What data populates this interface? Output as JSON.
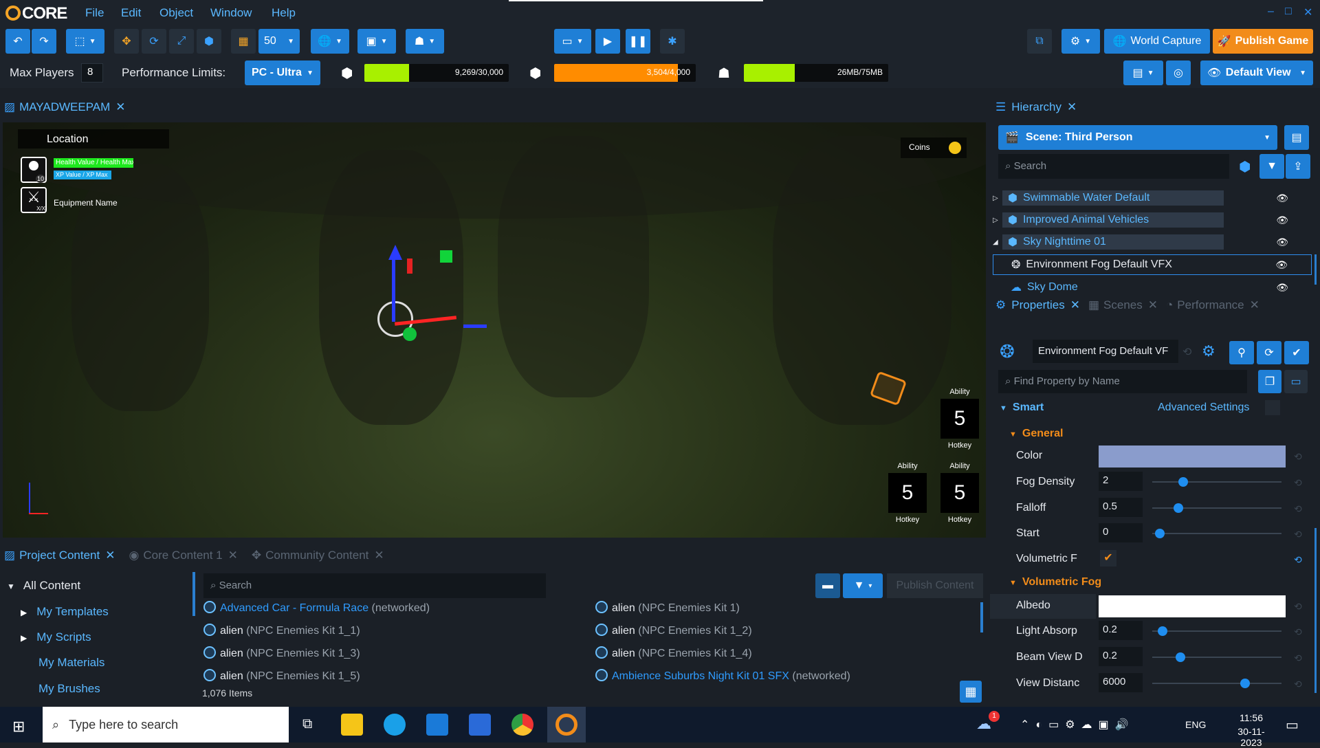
{
  "app": {
    "logo_text": "CORE",
    "accent": "#1f8ef0",
    "orange": "#f28c1a"
  },
  "menu": [
    "File",
    "Edit",
    "Object",
    "Window",
    "Help"
  ],
  "window_controls": [
    "–",
    "□",
    "✕"
  ],
  "toolbar": {
    "grid_value": "50",
    "world_capture": "World Capture",
    "publish_game": "Publish Game"
  },
  "perf": {
    "max_players_label": "Max Players",
    "max_players_value": "8",
    "limits_label": "Performance Limits:",
    "limits_value": "PC - Ultra",
    "meters": [
      {
        "text": "9,269/30,000",
        "fraction": 0.31,
        "color": "#a8f000"
      },
      {
        "text": "3,504/4,000",
        "fraction": 0.876,
        "color": "#ff8c00"
      },
      {
        "text": "26MB/75MB",
        "fraction": 0.35,
        "color": "#a8f000"
      }
    ],
    "default_view": "Default View"
  },
  "viewport": {
    "tab_label": "MAYADWEEPAM",
    "hud": {
      "location": "Location",
      "health": "Health Value / Health Max",
      "xp": "XP Value / XP Max",
      "level": "10",
      "equipment": "Equipment Name",
      "equip_xx": "X/X",
      "coins": "Coins",
      "abilities": [
        {
          "title": "Ability",
          "value": "5",
          "hotkey": "Hotkey"
        },
        {
          "title": "Ability",
          "value": "5",
          "hotkey": "Hotkey"
        },
        {
          "title": "Ability",
          "value": "5",
          "hotkey": "Hotkey"
        }
      ]
    }
  },
  "content": {
    "tabs": [
      "Project Content",
      "Core Content 1",
      "Community Content"
    ],
    "tree": {
      "root": "All Content",
      "items": [
        "My Templates",
        "My Scripts",
        "My Materials",
        "My Brushes"
      ]
    },
    "search_placeholder": "Search",
    "publish_content": "Publish Content",
    "assets_left": [
      {
        "name": "Advanced Car - Formula Race",
        "suffix": "(networked)",
        "link": true
      },
      {
        "name": "alien",
        "suffix": "(NPC Enemies Kit 1_1)",
        "link": false
      },
      {
        "name": "alien",
        "suffix": "(NPC Enemies Kit 1_3)",
        "link": false
      },
      {
        "name": "alien",
        "suffix": "(NPC Enemies Kit 1_5)",
        "link": false
      }
    ],
    "assets_right": [
      {
        "name": "alien",
        "suffix": "(NPC Enemies Kit 1)",
        "link": false
      },
      {
        "name": "alien",
        "suffix": "(NPC Enemies Kit 1_2)",
        "link": false
      },
      {
        "name": "alien",
        "suffix": "(NPC Enemies Kit 1_4)",
        "link": false
      },
      {
        "name": "Ambience Suburbs Night Kit 01 SFX",
        "suffix": "(networked)",
        "link": true
      }
    ],
    "item_count": "1,076 Items"
  },
  "hierarchy": {
    "tab_label": "Hierarchy",
    "scene": "Scene: Third Person",
    "search_placeholder": "Search",
    "items": [
      {
        "label": "Swimmable Water Default",
        "boxed": true
      },
      {
        "label": "Improved Animal Vehicles",
        "boxed": true
      },
      {
        "label": "Sky Nighttime 01",
        "boxed": true
      },
      {
        "label": "Environment Fog Default VFX",
        "boxed": false,
        "selected": true
      },
      {
        "label": "Sky Dome",
        "boxed": false
      }
    ]
  },
  "properties": {
    "tabs": [
      "Properties",
      "Scenes",
      "Performance"
    ],
    "object_name": "Environment Fog Default VF",
    "find_placeholder": "Find Property by Name",
    "smart": "Smart",
    "advanced": "Advanced Settings",
    "general": "General",
    "volumetric_section": "Volumetric Fog",
    "color_label": "Color",
    "fog_color": "#8a9ccc",
    "rows": [
      {
        "label": "Fog Density",
        "value": "2",
        "knob": 0.24
      },
      {
        "label": "Falloff",
        "value": "0.5",
        "knob": 0.2
      },
      {
        "label": "Start",
        "value": "0",
        "knob": 0.06
      }
    ],
    "volumetric_label": "Volumetric F",
    "albedo_label": "Albedo",
    "albedo_color": "#ffffff",
    "vrows": [
      {
        "label": "Light Absorp",
        "value": "0.2",
        "knob": 0.08
      },
      {
        "label": "Beam View D",
        "value": "0.2",
        "knob": 0.22
      },
      {
        "label": "View Distanc",
        "value": "6000",
        "knob": 0.72
      }
    ]
  },
  "taskbar": {
    "search_placeholder": "Type here to search",
    "lang": "ENG",
    "time": "11:56",
    "date": "30-11-2023",
    "badge": "1"
  }
}
